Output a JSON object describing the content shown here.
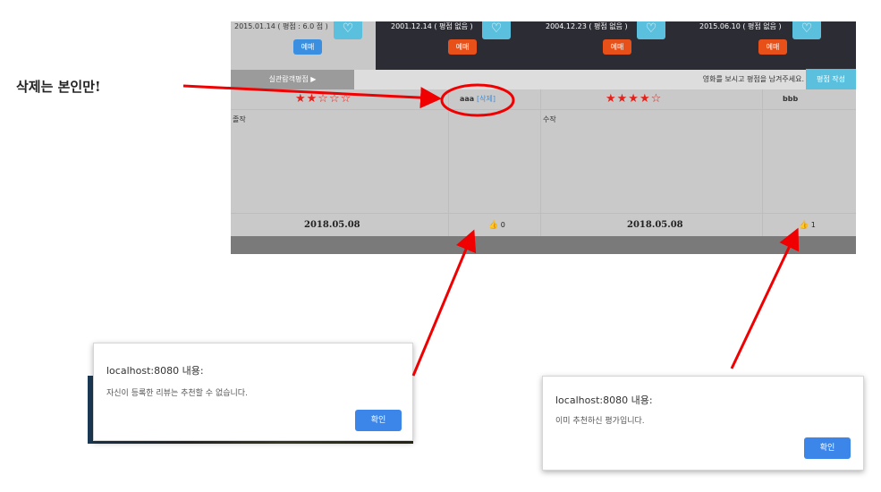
{
  "annotation": {
    "label": "삭제는 본인만!"
  },
  "movies": [
    {
      "date": "2015.01.14 ( 평점 : 6.0 점 )",
      "reserve": "예매"
    },
    {
      "date": "2001.12.14 ( 평점 없음 )",
      "reserve": "예매"
    },
    {
      "date": "2004.12.23 ( 평점 없음 )",
      "reserve": "예매"
    },
    {
      "date": "2015.06.10 ( 평점 없음 )",
      "reserve": "예매"
    }
  ],
  "tabs": {
    "active": "실관람객평점 ▶",
    "hint": "영화를 보시고 평점을 남겨주세요.",
    "write": "평점 작성"
  },
  "reviews": [
    {
      "stars": "★★☆☆☆",
      "author": "aaa",
      "delete": "[삭제]",
      "body": "졸작",
      "date": "2018.05.08",
      "likes": "0"
    },
    {
      "stars": "★★★★☆",
      "author": "bbb",
      "delete": "",
      "body": "수작",
      "date": "2018.05.08",
      "likes": "1"
    }
  ],
  "dialogs": [
    {
      "title": "localhost:8080 내용:",
      "message": "자신이 등록한 리뷰는 추천할 수 없습니다.",
      "ok": "확인"
    },
    {
      "title": "localhost:8080 내용:",
      "message": "이미 추천하신 평가입니다.",
      "ok": "확인"
    }
  ],
  "colors": {
    "arrow": "#f00000",
    "accent": "#5bc0de",
    "reserve": "#e8501a"
  }
}
